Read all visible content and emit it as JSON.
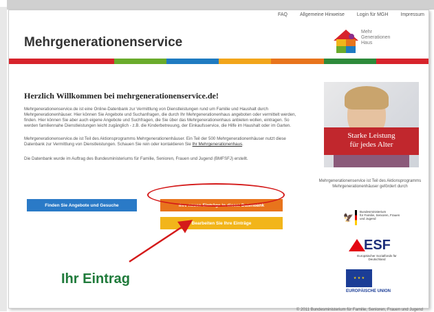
{
  "nav": [
    "FAQ",
    "Allgemeine Hinweise",
    "Login für MGH",
    "Impressum"
  ],
  "site_title": "Mehrgenerationenservice",
  "logo_text": [
    "Mehr",
    "Generationen",
    "Haus"
  ],
  "stripe_colors": [
    "#d7232b",
    "#d7232b",
    "#6aab2b",
    "#1f7bc1",
    "#f2a51a",
    "#e8741c",
    "#2d8a3a",
    "#d7232b"
  ],
  "welcome": {
    "heading": "Herzlich Willkommen bei mehrgenerationenservice.de!",
    "p1": "Mehrgenerationenservice.de ist eine Online-Datenbank zur Vermittlung von Dienstleistungen rund um Familie und Haushalt durch Mehrgenerationenhäuser. Hier können Sie Angebote und Suchanfragen, die durch Ihr Mehrgenerationenhaus angeboten oder vermittelt werden, finden. Hier können Sie aber auch eigene Angebote und Suchfragen, die Sie über das Mehrgenerationenhaus anbieten wollen, eintragen. So werden familiennahe Dienstleistungen leicht zugänglich - z.B. die Kinderbetreuung, der Einkaufsservice, die Hilfe im Haushalt oder im Garten.",
    "p2": "Mehrgenerationenservice.de ist Teil des Aktionsprogramms Mehrgenerationenhäuser. Ein Teil der 500 Mehrgenerationenhäuser nutzt diese Datenbank zur Vermittlung von Dienstleistungen. Schauen Sie rein oder kontaktieren Sie",
    "p2_link": "Ihr Mehrgenerationenhaus",
    "p3": "Die Datenbank wurde im Auftrag des Bundesministeriums für Familie, Senioren, Frauen und Jugend (BMFSFJ) erstellt."
  },
  "hero_caption": [
    "Starke Leistung",
    "für jedes Alter"
  ],
  "side_note": "Mehrgenerationenservice ist Teil des Aktionsprogramms Mehrgenerationenhäuser gefördert durch",
  "ministry": [
    "Bundesministerium",
    "für Familie, Senioren, Frauen",
    "und Jugend"
  ],
  "esf": {
    "word": "ESF",
    "sub": "Europäischer Sozialfonds für Deutschland"
  },
  "eu": {
    "label": "EUROPÄISCHE UNION"
  },
  "buttons": {
    "find": "Finden Sie Angebote und Gesuche",
    "new_entries": "Ihre neuen Einträge in dieser Datenbank",
    "edit": "Bearbeiten Sie Ihre Einträge"
  },
  "annotation": "Ihr Eintrag",
  "annotation_colors": {
    "circle": "#d41a1a",
    "text": "#1f7a3a"
  },
  "footer": "© 2011 Bundesministerium für Familie, Senioren, Frauen und Jugend"
}
